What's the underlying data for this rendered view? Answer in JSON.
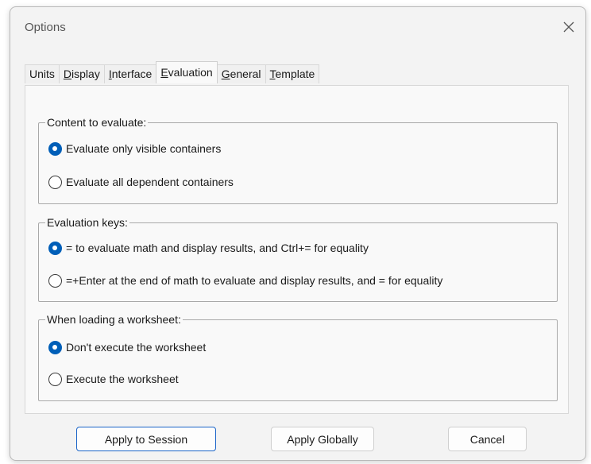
{
  "window": {
    "title": "Options"
  },
  "tabs": [
    {
      "label": "Units",
      "mnemonic": "",
      "active": false
    },
    {
      "label": "Display",
      "mnemonic": "D",
      "active": false
    },
    {
      "label": "Interface",
      "mnemonic": "I",
      "active": false
    },
    {
      "label": "Evaluation",
      "mnemonic": "E",
      "active": true
    },
    {
      "label": "General",
      "mnemonic": "G",
      "active": false
    },
    {
      "label": "Template",
      "mnemonic": "T",
      "active": false
    }
  ],
  "groups": {
    "content": {
      "legend": "Content to evaluate:",
      "options": [
        {
          "label": "Evaluate only visible containers",
          "checked": true
        },
        {
          "label": "Evaluate all dependent containers",
          "checked": false
        }
      ]
    },
    "keys": {
      "legend": "Evaluation keys:",
      "options": [
        {
          "label": "= to evaluate math and display results, and Ctrl+= for equality",
          "checked": true
        },
        {
          "label": "=+Enter at the end of math to evaluate and display results, and = for equality",
          "checked": false
        }
      ]
    },
    "loading": {
      "legend": "When loading a worksheet:",
      "options": [
        {
          "label": "Don't execute the worksheet",
          "checked": true
        },
        {
          "label": "Execute the worksheet",
          "checked": false
        }
      ]
    }
  },
  "buttons": {
    "apply_session": "Apply to Session",
    "apply_globally": "Apply Globally",
    "cancel": "Cancel"
  },
  "colors": {
    "accent": "#005fb8",
    "primary_border": "#1a64c8"
  },
  "icons": {
    "close": "close-icon"
  }
}
